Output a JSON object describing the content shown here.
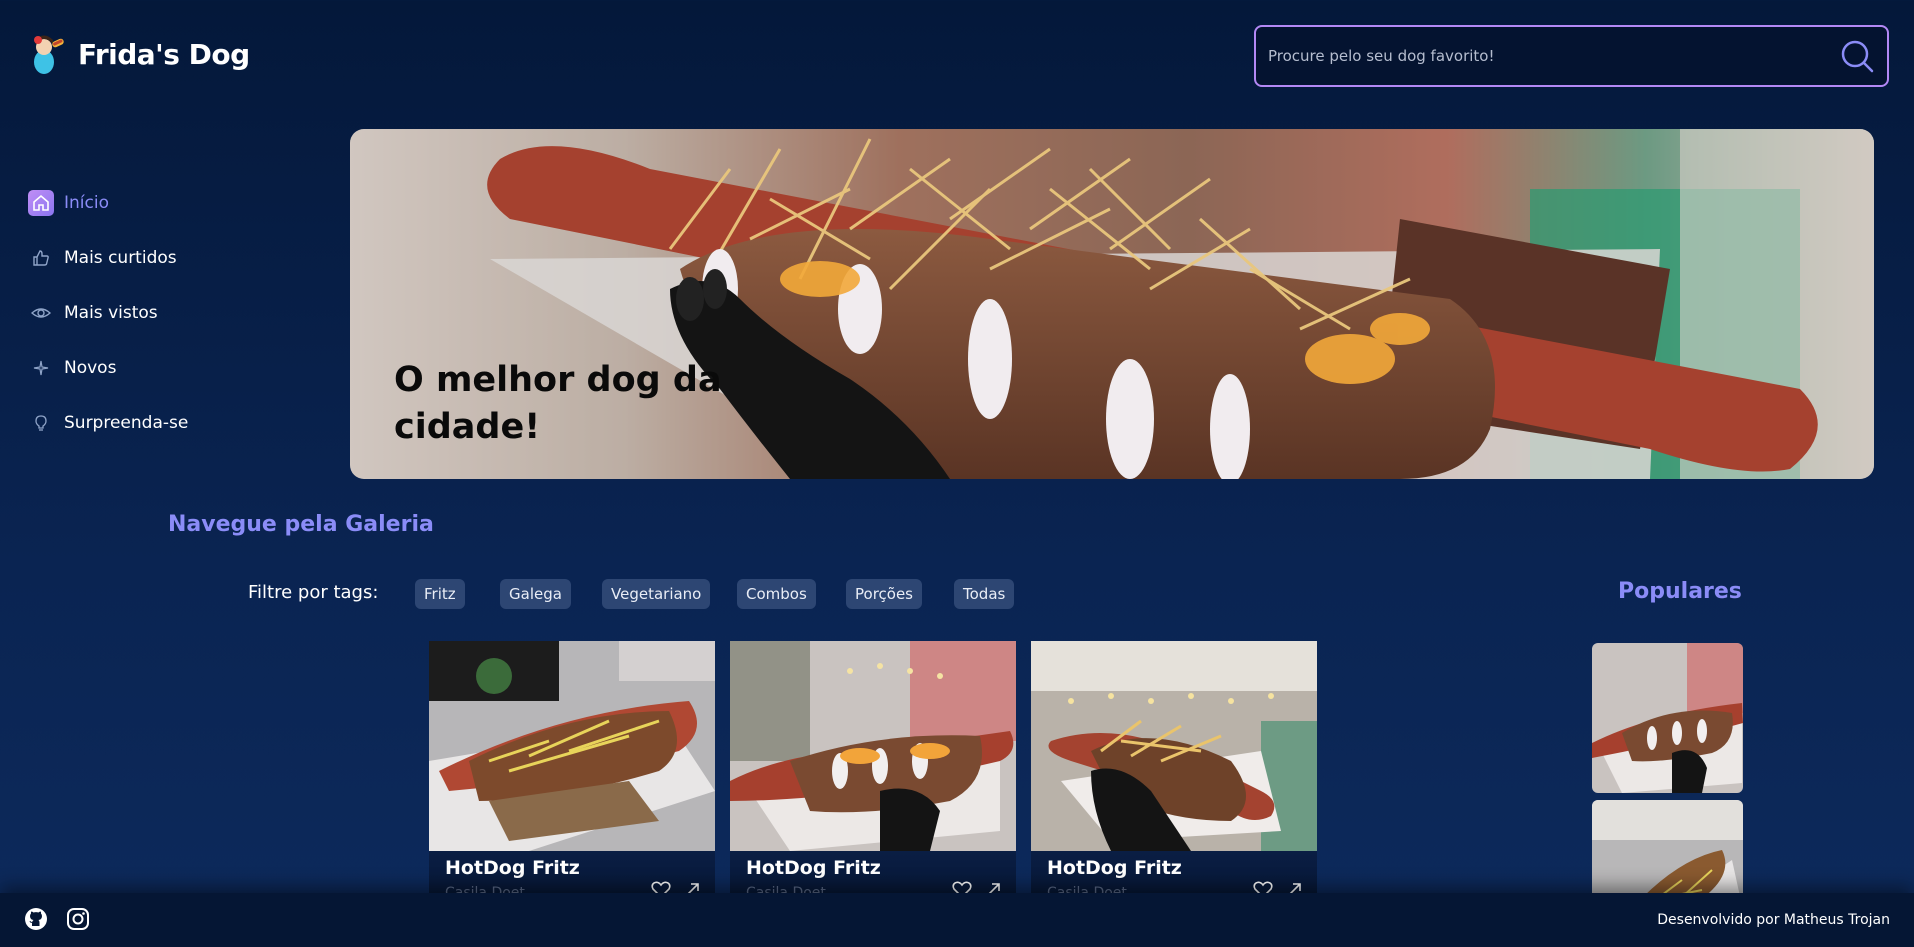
{
  "header": {
    "brand": "Frida's Dog",
    "search_placeholder": "Procure pelo seu dog favorito!"
  },
  "sidebar": {
    "items": [
      {
        "label": "Início",
        "icon": "home-icon",
        "active": true
      },
      {
        "label": "Mais curtidos",
        "icon": "thumbs-up-icon",
        "active": false
      },
      {
        "label": "Mais vistos",
        "icon": "eye-icon",
        "active": false
      },
      {
        "label": "Novos",
        "icon": "sparkle-icon",
        "active": false
      },
      {
        "label": "Surpreenda-se",
        "icon": "lightbulb-icon",
        "active": false
      }
    ]
  },
  "banner": {
    "headline": "O melhor dog da cidade!"
  },
  "gallery": {
    "title": "Navegue pela Galeria",
    "filter_label": "Filtre por tags:",
    "tags": [
      "Fritz",
      "Galega",
      "Vegetariano",
      "Combos",
      "Porções",
      "Todas"
    ],
    "cards": [
      {
        "name": "HotDog Fritz",
        "subtitle": "Casila Doet..."
      },
      {
        "name": "HotDog Fritz",
        "subtitle": "Casila Doet..."
      },
      {
        "name": "HotDog Fritz",
        "subtitle": "Casila Doet..."
      }
    ]
  },
  "popular": {
    "title": "Populares"
  },
  "footer": {
    "credit": "Desenvolvido por Matheus Trojan",
    "social": [
      "github-icon",
      "instagram-icon"
    ]
  },
  "colors": {
    "accent": "#8b8cf7",
    "search_border": "#b388f5",
    "tag_bg": "#2d4673",
    "background": "#04183a"
  }
}
